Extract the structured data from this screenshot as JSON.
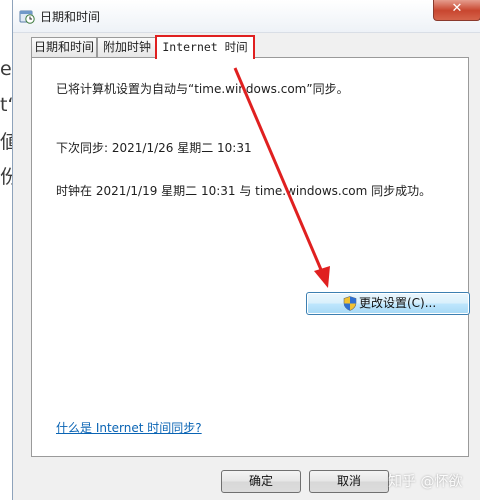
{
  "background_fragments": [
    "e",
    "t“",
    "値",
    "份"
  ],
  "window": {
    "title": "日期和时间",
    "close_label": "✕"
  },
  "tabs": [
    {
      "label": "日期和时间",
      "active": false
    },
    {
      "label": "附加时钟",
      "active": false
    },
    {
      "label": "Internet 时间",
      "active": true
    }
  ],
  "panel": {
    "sync_info": "已将计算机设置为自动与“time.windows.com”同步。",
    "next_sync": "下次同步: 2021/1/26 星期二 10:31",
    "last_sync": "时钟在 2021/1/19 星期二 10:31 与 time.windows.com 同步成功。",
    "change_settings_label": "更改设置(C)...",
    "help_link": "什么是 Internet 时间同步?"
  },
  "buttons": {
    "ok": "确定",
    "cancel": "取消"
  },
  "watermark": "知乎 @怀欲",
  "colors": {
    "highlight": "#e02020",
    "arrow": "#e02020",
    "link": "#0a64b4"
  },
  "icons": {
    "title": "clock-icon",
    "change_settings": "uac-shield-icon"
  }
}
